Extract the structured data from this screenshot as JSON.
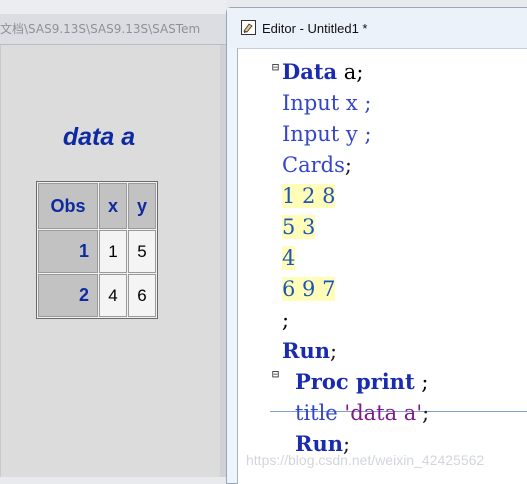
{
  "output_window": {
    "path_text": "文档\\SAS9.13S\\SAS9.13S\\SASTem",
    "title": "data a",
    "table": {
      "headers": [
        "Obs",
        "x",
        "y"
      ],
      "rows": [
        {
          "obs": "1",
          "x": "1",
          "y": "5"
        },
        {
          "obs": "2",
          "x": "4",
          "y": "6"
        }
      ]
    }
  },
  "editor": {
    "window_title": "Editor - Untitled1 *",
    "fold_symbol": "⊟",
    "lines": {
      "l1_kw": "Data",
      "l1_rest": " a;",
      "l2": "Input x ;",
      "l3": "Input y ;",
      "l4_kw": "Cards",
      "l4_semi": ";",
      "l5": "1 2 8",
      "l6": "5 3",
      "l7": "4",
      "l8": "6 9 7",
      "l9": ";",
      "l10_kw": "Run",
      "l10_semi": ";",
      "l11_kw": "Proc print",
      "l11_rest": " ;",
      "l12_kw": "title",
      "l12_str": " 'data a'",
      "l12_semi": ";",
      "l13_kw": "Run",
      "l13_semi": ";"
    }
  },
  "watermark": "https://blog.csdn.net/weixin_42425562"
}
